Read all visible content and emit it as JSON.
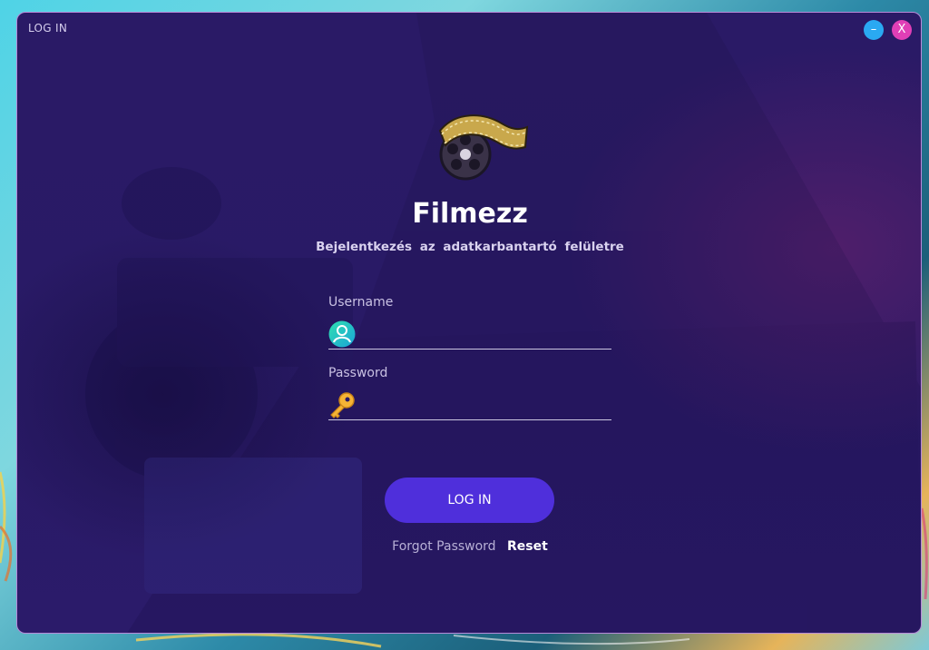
{
  "window": {
    "title": "LOG IN",
    "minimize_label": "–",
    "close_label": "X"
  },
  "brand": {
    "logo_icon": "film-reel-icon",
    "name": "Filmezz",
    "subtitle": "Bejelentkezés az adatkarbantartó felületre"
  },
  "form": {
    "username": {
      "label": "Username",
      "value": "",
      "icon": "user-icon"
    },
    "password": {
      "label": "Password",
      "value": "",
      "icon": "key-icon"
    },
    "login_button": "LOG IN",
    "forgot_text": "Forgot Password",
    "reset_link": "Reset"
  },
  "colors": {
    "accent_button": "#4f2fdb",
    "minimize": "#2aa9f2",
    "close": "#e03fb6",
    "window_bg": "#2a1a66"
  }
}
